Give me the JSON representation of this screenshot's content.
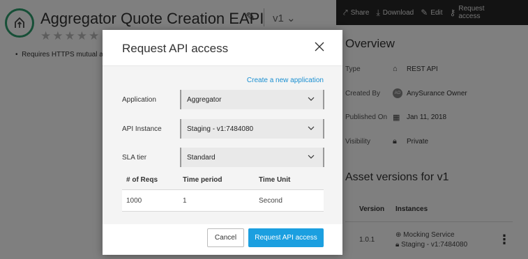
{
  "background": {
    "asset_title": "Aggregator Quote Creation EAPI",
    "version": "v1",
    "stars": "★★★★★",
    "bullet_text": "Requires HTTPS mutual a",
    "toolbar": {
      "share": "Share",
      "download": "Download",
      "edit": "Edit",
      "request_access": "Request access"
    },
    "overview": {
      "heading": "Overview",
      "type_key": "Type",
      "type_val": "REST API",
      "created_key": "Created By",
      "created_avatar": "AO",
      "created_val": "AnySurance Owner",
      "published_key": "Published On",
      "published_val": "Jan 11, 2018",
      "visibility_key": "Visibility",
      "visibility_val": "Private"
    },
    "versions": {
      "heading": "Asset versions for v1",
      "col_version": "Version",
      "col_instances": "Instances",
      "row_version": "1.0.1",
      "instance_1": "Mocking Service",
      "instance_2": "Staging - v1:7484080"
    }
  },
  "modal": {
    "title": "Request API access",
    "create_link": "Create a new application",
    "application": {
      "label": "Application",
      "value": "Aggregator"
    },
    "api_instance": {
      "label": "API Instance",
      "value": "Staging - v1:7484080"
    },
    "sla_tier": {
      "label": "SLA tier",
      "value": "Standard"
    },
    "sla_table": {
      "headers": [
        "# of Reqs",
        "Time period",
        "Time Unit"
      ],
      "rows": [
        [
          "1000",
          "1",
          "Second"
        ]
      ]
    },
    "cancel": "Cancel",
    "submit": "Request API access"
  }
}
